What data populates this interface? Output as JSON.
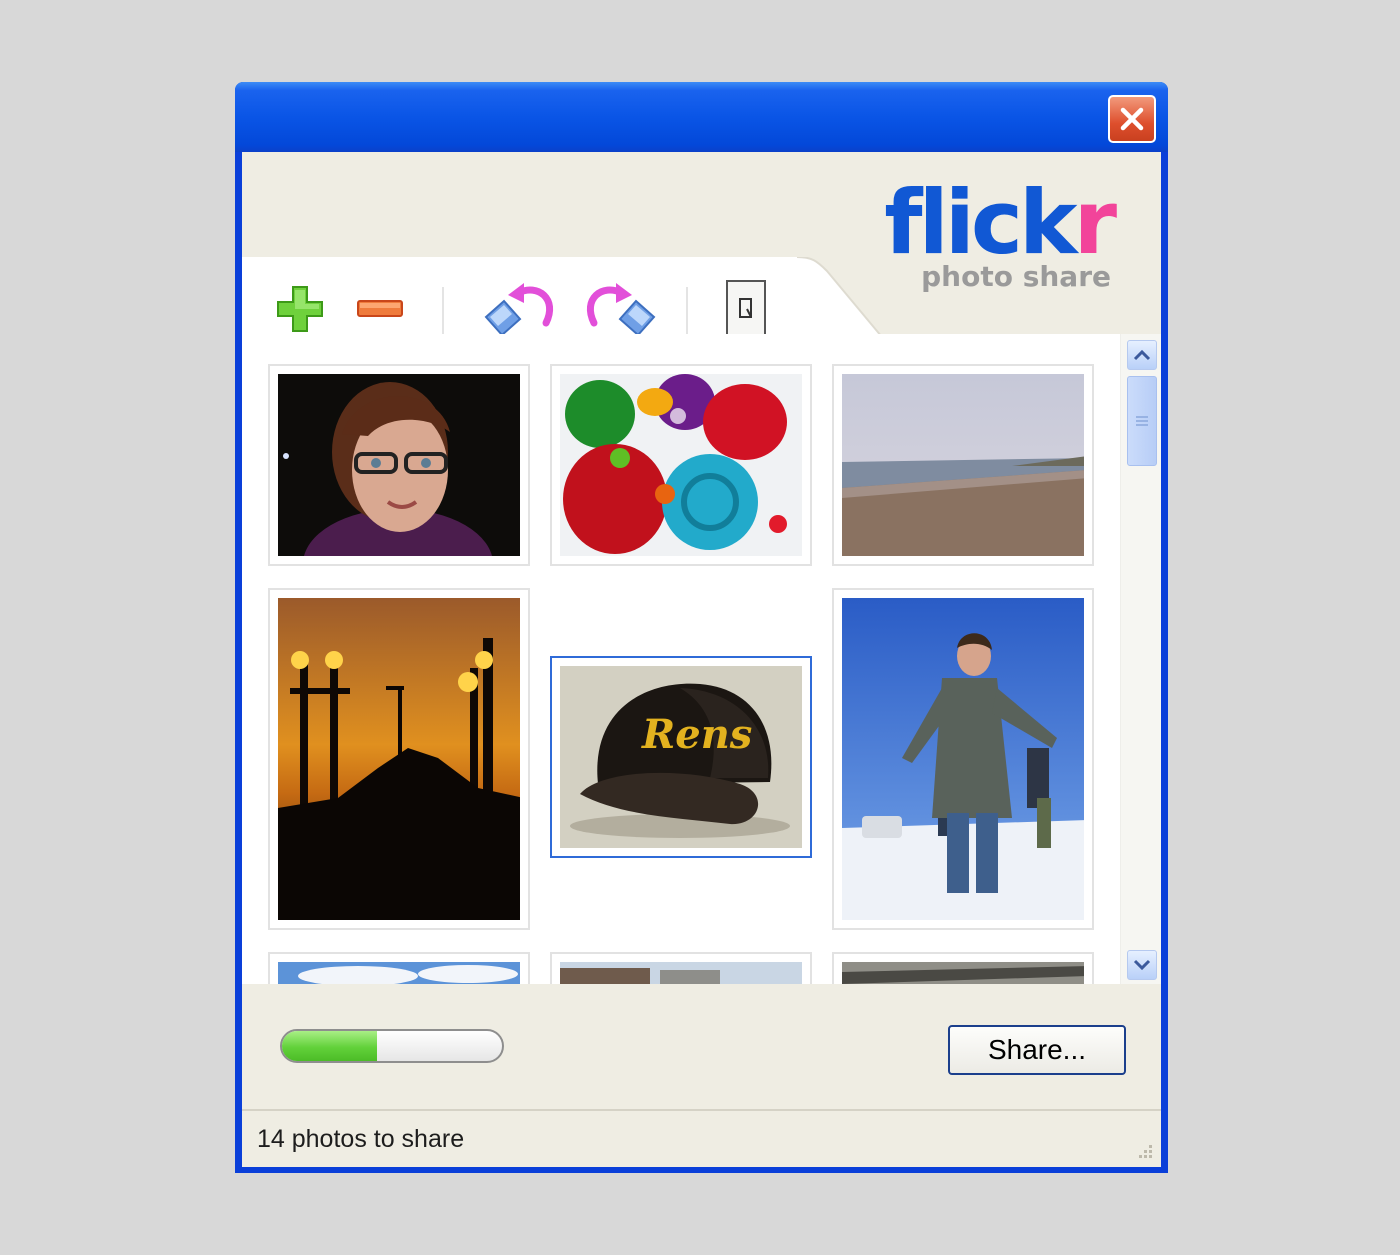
{
  "window": {
    "title": "",
    "close_icon": "close-icon"
  },
  "logo": {
    "word_blue": "flick",
    "word_pink": "r",
    "subtitle": "photo share"
  },
  "toolbar": {
    "buttons": [
      {
        "name": "add-photo-button",
        "icon": "plus-icon"
      },
      {
        "name": "remove-photo-button",
        "icon": "minus-icon"
      },
      {
        "name": "rotate-left-button",
        "icon": "rotate-left-icon"
      },
      {
        "name": "rotate-right-button",
        "icon": "rotate-right-icon"
      },
      {
        "name": "photo-properties-button",
        "icon": "properties-icon"
      }
    ]
  },
  "photos": [
    {
      "subject": "portrait-woman-glasses",
      "selected": false
    },
    {
      "subject": "colorful-toys",
      "selected": false
    },
    {
      "subject": "beach",
      "selected": false
    },
    {
      "subject": "street-lamps-sunset",
      "selected": false
    },
    {
      "subject": "rens-cap",
      "selected": true
    },
    {
      "subject": "person-in-snow",
      "selected": false
    }
  ],
  "progress": {
    "fraction": 0.43,
    "color": "#62d13a"
  },
  "share_button_label": "Share...",
  "status": {
    "text": "14 photos to share"
  },
  "colors": {
    "titlebar": "#0a55e6",
    "accent_blue": "#1158d4",
    "accent_pink": "#f2449a",
    "close": "#de4f2d"
  }
}
